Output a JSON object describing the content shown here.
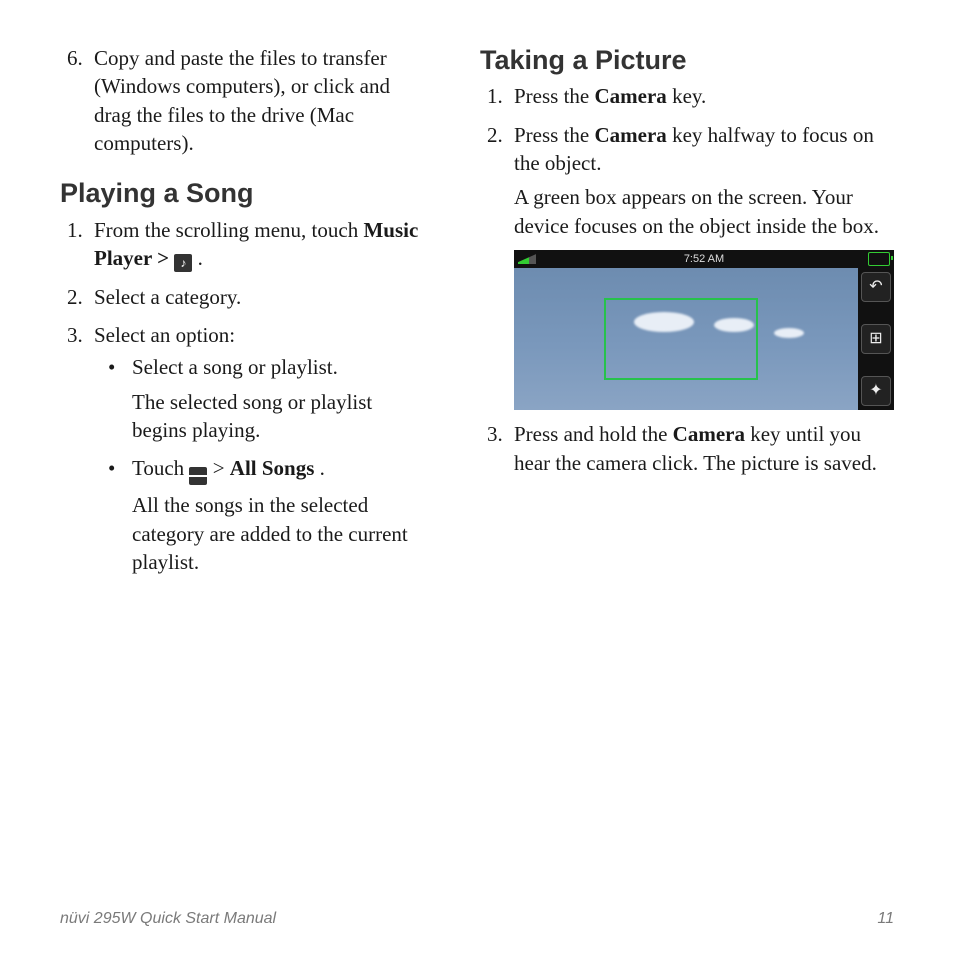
{
  "left": {
    "step6": "Copy and paste the files to transfer (Windows computers), or click and drag the files to the drive (Mac computers).",
    "heading": "Playing a Song",
    "step1_a": "From the scrolling menu, touch ",
    "step1_b": "Music Player > ",
    "step1_c": ".",
    "step2": "Select a category.",
    "step3": "Select an option:",
    "b1a": "Select a song or playlist.",
    "b1b": "The selected song or playlist begins playing.",
    "b2a_pre": "Touch ",
    "b2a_mid": " > ",
    "b2a_bold": "All Songs",
    "b2a_post": ".",
    "b2b": "All the songs in the selected category are added to the current playlist."
  },
  "right": {
    "heading": "Taking a Picture",
    "s1_a": "Press the ",
    "s1_b": "Camera",
    "s1_c": " key.",
    "s2_a": "Press the ",
    "s2_b": "Camera",
    "s2_c": " key halfway to focus on the object.",
    "s2_note": "A green box appears on the screen. Your device focuses on the object inside the box.",
    "s3_a": "Press and hold the ",
    "s3_b": "Camera",
    "s3_c": " key until you hear the camera click. The picture is saved.",
    "cam_time": "7:52 AM"
  },
  "footer": {
    "left": "nüvi 295W Quick Start Manual",
    "right": "11"
  },
  "icons": {
    "music": "♪",
    "back": "↶",
    "grid": "⊞",
    "flash": "✦"
  }
}
